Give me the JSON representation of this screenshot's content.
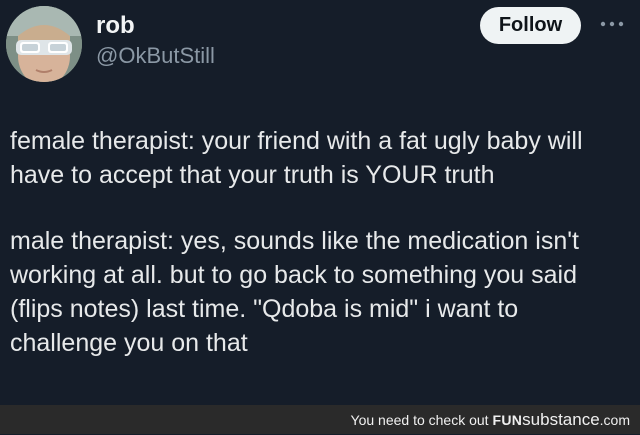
{
  "author": {
    "name": "rob",
    "handle": "@OkButStill"
  },
  "actions": {
    "follow_label": "Follow",
    "more_icon": "ellipsis-icon"
  },
  "tweet": {
    "paragraphs": [
      "female therapist: your friend with a fat ugly baby will have to accept that your truth is YOUR truth",
      "male therapist: yes, sounds like the medication isn't working at all. but to go back to something you said (flips notes) last time. \"Qdoba is mid\" i want to challenge you on that"
    ]
  },
  "watermark": {
    "prefix": "You need to check out",
    "brand_fun": "FUN",
    "brand_substance": "substance",
    "brand_tld": ".com"
  },
  "colors": {
    "background": "#151d29",
    "text": "#e7e9ea",
    "secondary_text": "#8b98a5",
    "follow_button_bg": "#eff3f4",
    "watermark_bar": "#2a2a2a"
  }
}
